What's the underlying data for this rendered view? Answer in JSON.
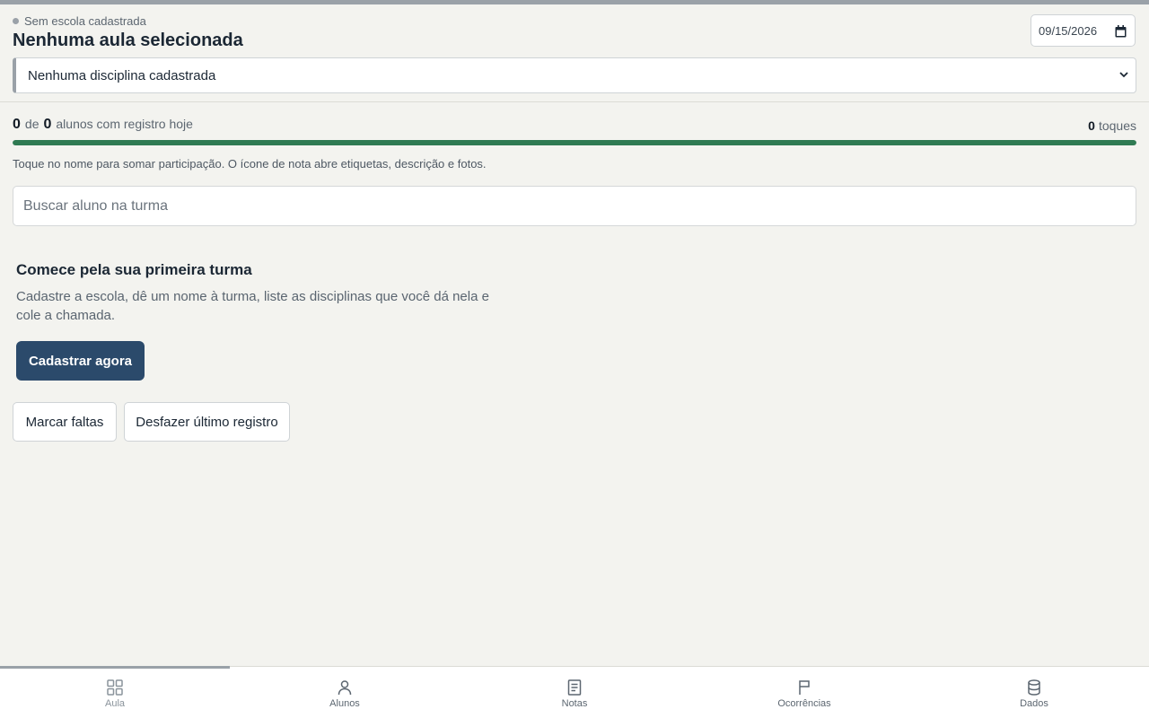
{
  "header": {
    "school_status": "Sem escola cadastrada",
    "lesson_title": "Nenhuma aula selecionada",
    "date_value": "09/15/2026",
    "subject_selected": "Nenhuma disciplina cadastrada"
  },
  "stats": {
    "registered_count": "0",
    "of_label": "de",
    "total_count": "0",
    "students_label": "alunos com registro hoje",
    "touches_count": "0",
    "touches_label": "toques",
    "progress_fraction": 1.0
  },
  "hint": "Toque no nome para somar participação. O ícone de nota abre etiquetas, descrição e fotos.",
  "search": {
    "placeholder": "Buscar aluno na turma"
  },
  "empty_state": {
    "title": "Comece pela sua primeira turma",
    "description": "Cadastre a escola, dê um nome à turma, liste as disciplinas que você dá nela e cole a chamada.",
    "cta_label": "Cadastrar agora"
  },
  "actions": {
    "mark_absences": "Marcar faltas",
    "undo_last": "Desfazer último registro"
  },
  "nav": {
    "items": [
      {
        "label": "Aula",
        "icon": "grid-icon",
        "active": true
      },
      {
        "label": "Alunos",
        "icon": "user-icon",
        "active": false
      },
      {
        "label": "Notas",
        "icon": "document-icon",
        "active": false
      },
      {
        "label": "Ocorrências",
        "icon": "flag-icon",
        "active": false
      },
      {
        "label": "Dados",
        "icon": "database-icon",
        "active": false
      }
    ]
  },
  "colors": {
    "background": "#f3f3ef",
    "primary": "#2b4a6b",
    "progress": "#2f7a52",
    "muted": "#9aa1a8"
  }
}
